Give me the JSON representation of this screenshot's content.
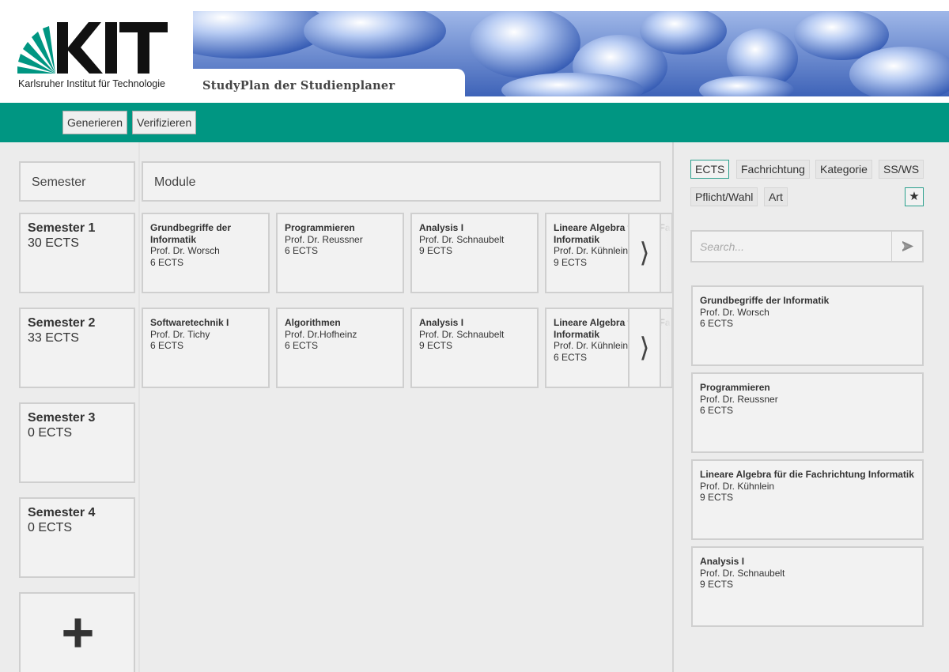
{
  "header": {
    "logo_text": "KIT",
    "logo_subtitle": "Karlsruher Institut für Technologie",
    "app_title": "StudyPlan der Studienplaner"
  },
  "toolbar": {
    "generate_label": "Generieren",
    "verify_label": "Verifizieren"
  },
  "plan": {
    "semester_header": "Semester",
    "module_header": "Module",
    "semesters": [
      {
        "title": "Semester 1",
        "ects": "30 ECTS",
        "modules": [
          {
            "name": "Grundbegriffe der Informatik",
            "prof": "Prof. Dr. Worsch",
            "ects": "6 ECTS"
          },
          {
            "name": "Programmieren",
            "prof": "Prof. Dr. Reussner",
            "ects": "6 ECTS"
          },
          {
            "name": "Analysis I",
            "prof": "Prof. Dr. Schnaubelt",
            "ects": "9 ECTS"
          },
          {
            "name": "Lineare Algebra für die Fachrichtung Informatik",
            "prof": "Prof. Dr. Kühnlein",
            "ects": "9 ECTS"
          }
        ]
      },
      {
        "title": "Semester 2",
        "ects": "33 ECTS",
        "modules": [
          {
            "name": "Softwaretechnik I",
            "prof": "Prof. Dr. Tichy",
            "ects": "6 ECTS"
          },
          {
            "name": "Algorithmen",
            "prof": "Prof. Dr.Hofheinz",
            "ects": "6 ECTS"
          },
          {
            "name": "Analysis I",
            "prof": "Prof. Dr. Schnaubelt",
            "ects": "9 ECTS"
          },
          {
            "name": "Lineare Algebra für die Fachrichtung Informatik",
            "prof": "Prof. Dr. Kühnlein",
            "ects": "6 ECTS"
          }
        ]
      },
      {
        "title": "Semester 3",
        "ects": "0 ECTS",
        "modules": []
      },
      {
        "title": "Semester 4",
        "ects": "0 ECTS",
        "modules": []
      }
    ],
    "next_arrow": "⟩",
    "add_semester_icon": "plus-icon"
  },
  "sidebar": {
    "filters": [
      "ECTS",
      "Fachrichtung",
      "Kategorie",
      "SS/WS",
      "Pflicht/Wahl",
      "Art"
    ],
    "active_filter": "ECTS",
    "star_label": "★",
    "search_placeholder": "Search...",
    "search_value": "",
    "search_icon": "send-arrow-icon",
    "modules": [
      {
        "name": "Grundbegriffe der Informatik",
        "prof": "Prof. Dr. Worsch",
        "ects": "6 ECTS"
      },
      {
        "name": "Programmieren",
        "prof": "Prof. Dr. Reussner",
        "ects": "6 ECTS"
      },
      {
        "name": "Lineare Algebra für die Fachrichtung Informatik",
        "prof": "Prof. Dr. Kühnlein",
        "ects": "9 ECTS"
      },
      {
        "name": "Analysis I",
        "prof": "Prof. Dr. Schnaubelt",
        "ects": "9 ECTS"
      }
    ]
  },
  "colors": {
    "kit_green": "#009682",
    "panel_bg": "#ececec",
    "card_bg": "#f2f2f2",
    "card_border": "#cfcfcf"
  }
}
